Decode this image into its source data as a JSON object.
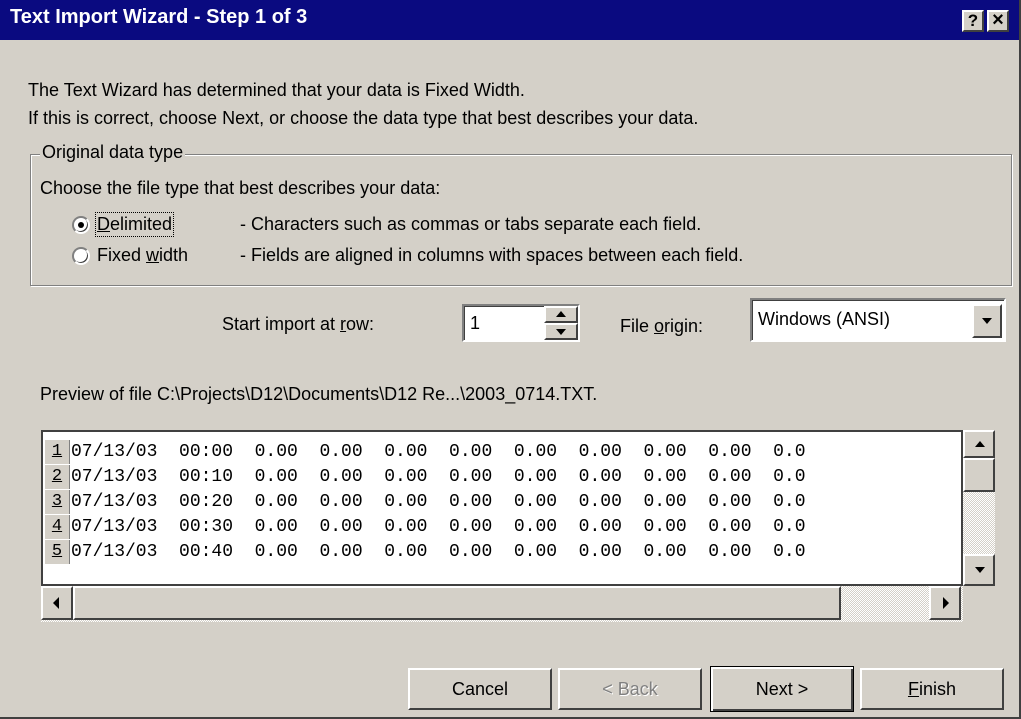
{
  "window": {
    "title": "Text Import Wizard - Step 1 of 3",
    "help_button": "?",
    "close_button": "×"
  },
  "intro": {
    "line1": "The Text Wizard has determined that your data is Fixed Width.",
    "line2": "If this is correct, choose Next, or choose the data type that best describes your data."
  },
  "original_data_type": {
    "legend": "Original data type",
    "prompt": "Choose the file type that best describes your data:",
    "options": [
      {
        "label_pre": "",
        "label_u": "D",
        "label_post": "elimited",
        "description": "- Characters such as commas or tabs separate each field.",
        "selected": true
      },
      {
        "label_pre": "Fixed ",
        "label_u": "w",
        "label_post": "idth",
        "description": "- Fields are aligned in columns with spaces between each field.",
        "selected": false
      }
    ]
  },
  "start_row": {
    "label_pre": "Start import at ",
    "label_u": "r",
    "label_post": "ow:",
    "value": "1"
  },
  "file_origin": {
    "label_pre": "File ",
    "label_u": "o",
    "label_post": "rigin:",
    "value": "Windows (ANSI)"
  },
  "preview": {
    "label": "Preview of file C:\\Projects\\D12\\Documents\\D12 Re...\\2003_0714.TXT.",
    "rows": [
      {
        "num": "1",
        "text": "07/13/03  00:00  0.00  0.00  0.00  0.00  0.00  0.00  0.00  0.00  0.0"
      },
      {
        "num": "2",
        "text": "07/13/03  00:10  0.00  0.00  0.00  0.00  0.00  0.00  0.00  0.00  0.0"
      },
      {
        "num": "3",
        "text": "07/13/03  00:20  0.00  0.00  0.00  0.00  0.00  0.00  0.00  0.00  0.0"
      },
      {
        "num": "4",
        "text": "07/13/03  00:30  0.00  0.00  0.00  0.00  0.00  0.00  0.00  0.00  0.0"
      },
      {
        "num": "5",
        "text": "07/13/03  00:40  0.00  0.00  0.00  0.00  0.00  0.00  0.00  0.00  0.0"
      }
    ]
  },
  "buttons": {
    "cancel": "Cancel",
    "back": "< Back",
    "next": "Next >",
    "finish_u": "F",
    "finish_post": "inish"
  },
  "colors": {
    "title_bar": "#0a0a80",
    "face": "#d4d0c8",
    "disabled_text": "#808080"
  }
}
